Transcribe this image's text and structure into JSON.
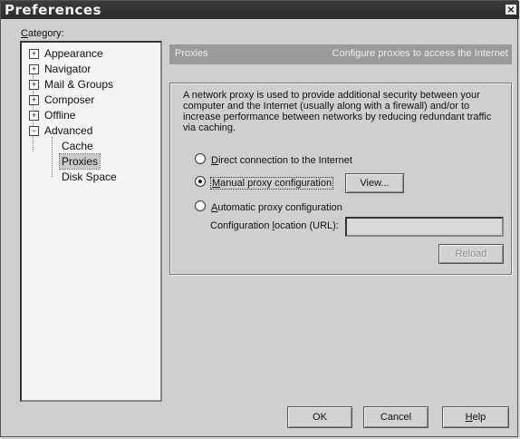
{
  "window": {
    "title": "Preferences",
    "close_glyph": "×"
  },
  "category": {
    "label_first": "C",
    "label_rest": "ategory:",
    "items": [
      {
        "label": "Appearance",
        "expander": "+"
      },
      {
        "label": "Navigator",
        "expander": "+"
      },
      {
        "label": "Mail & Groups",
        "expander": "+"
      },
      {
        "label": "Composer",
        "expander": "+"
      },
      {
        "label": "Offline",
        "expander": "+"
      },
      {
        "label": "Advanced",
        "expander": "−"
      }
    ],
    "children": [
      "Cache",
      "Proxies",
      "Disk Space"
    ],
    "selected": "Proxies"
  },
  "panel": {
    "header_title": "Proxies",
    "header_subtitle": "Configure proxies to access the Internet",
    "description": "A network proxy is used to provide additional security between your computer and the Internet (usually along with a firewall) and/or to increase performance between networks by reducing redundant traffic via caching.",
    "options": {
      "direct_first": "D",
      "direct_rest": "irect connection to the Internet",
      "manual_first": "M",
      "manual_rest": "anual proxy configuration",
      "auto_first": "A",
      "auto_rest": "utomatic proxy configuration"
    },
    "selected_option": "manual",
    "view_button": "View...",
    "config_label_a": "Configuration ",
    "config_label_u": "l",
    "config_label_b": "ocation (URL):",
    "url_value": "",
    "reload_button": "Reload"
  },
  "buttons": {
    "ok": "OK",
    "cancel": "Cancel",
    "help_first": "H",
    "help_rest": "elp"
  }
}
